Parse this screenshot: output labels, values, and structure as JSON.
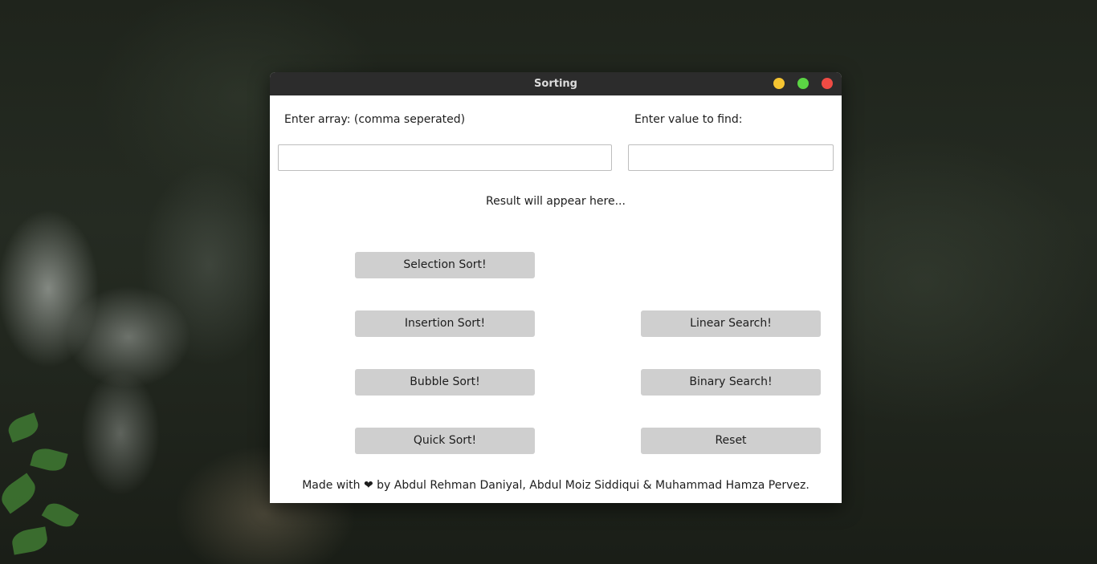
{
  "window": {
    "title": "Sorting",
    "controls": {
      "minimize_icon": "minimize-icon",
      "maximize_icon": "maximize-icon",
      "close_icon": "close-icon",
      "minimize_color": "#f5c431",
      "maximize_color": "#5bd444",
      "close_color": "#ef4b44"
    }
  },
  "form": {
    "array_label": "Enter array: (comma seperated)",
    "array_value": "",
    "find_label": "Enter value to find:",
    "find_value": ""
  },
  "result": {
    "text": "Result will appear here..."
  },
  "buttons": {
    "selection_sort": "Selection Sort!",
    "insertion_sort": "Insertion Sort!",
    "bubble_sort": "Bubble Sort!",
    "quick_sort": "Quick Sort!",
    "linear_search": "Linear Search!",
    "binary_search": "Binary Search!",
    "reset": "Reset"
  },
  "footer": {
    "text": "Made with ❤ by Abdul Rehman Daniyal, Abdul Moiz Siddiqui & Muhammad Hamza Pervez."
  },
  "colors": {
    "titlebar": "#2c2c2c",
    "window_bg": "#ffffff",
    "button_bg": "#cfcfcf"
  }
}
